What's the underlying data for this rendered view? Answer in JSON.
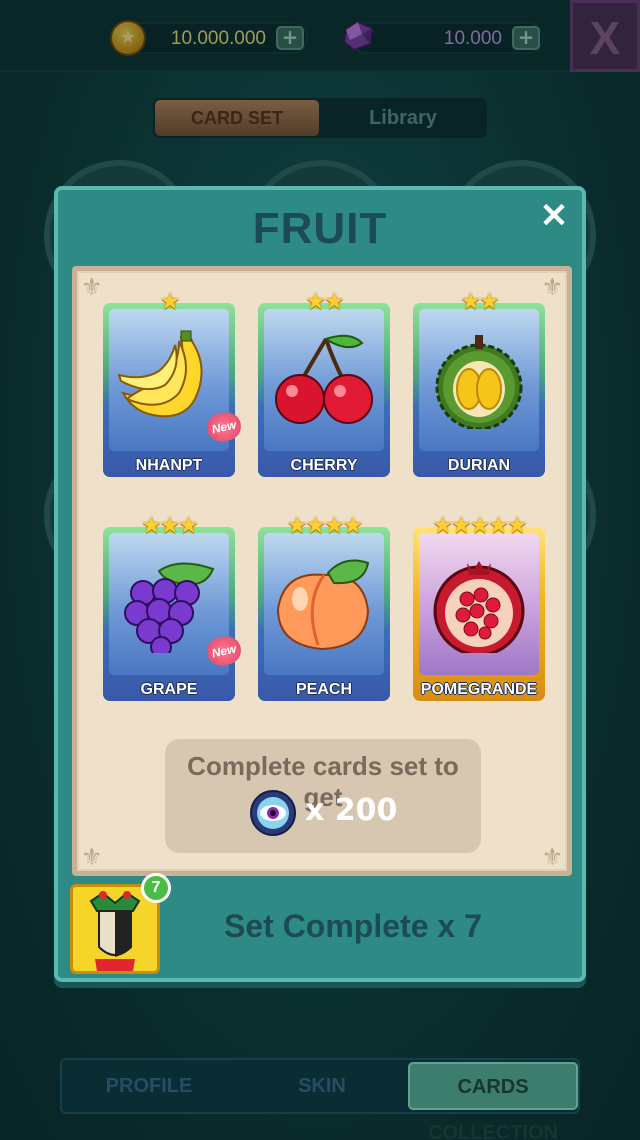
{
  "topbar": {
    "coins": "10.000.000",
    "gems": "10.000",
    "plus_label": "+",
    "close_label": "X"
  },
  "tabs": {
    "card_set": "CARD SET",
    "library": "Library"
  },
  "modal": {
    "title": "FRUIT",
    "close_label": "✕",
    "cards": [
      {
        "name": "NHANPT",
        "stars": 1,
        "is_new": true,
        "fruit": "banana"
      },
      {
        "name": "CHERRY",
        "stars": 2,
        "is_new": false,
        "fruit": "cherry"
      },
      {
        "name": "DURIAN",
        "stars": 2,
        "is_new": false,
        "fruit": "durian"
      },
      {
        "name": "GRAPE",
        "stars": 3,
        "is_new": true,
        "fruit": "grape"
      },
      {
        "name": "PEACH",
        "stars": 4,
        "is_new": false,
        "fruit": "peach"
      },
      {
        "name": "POMEGRANDE",
        "stars": 5,
        "is_new": false,
        "fruit": "pomegranate",
        "rarity": "gold"
      }
    ],
    "new_badge": "New",
    "reward_text": "Complete cards set to get",
    "reward_amount": "x 200",
    "reward_icon": "eye-token-icon",
    "set_complete_label": "Set Complete x 7",
    "set_complete_count": "7"
  },
  "bottom_nav": {
    "profile": "PROFILE",
    "skin": "SKIN",
    "cards_collection": "CARDS COLLECTION"
  },
  "colors": {
    "accent_teal": "#2d8a84",
    "panel_cream": "#efe0c9",
    "star_gold": "#ffcf2e"
  }
}
